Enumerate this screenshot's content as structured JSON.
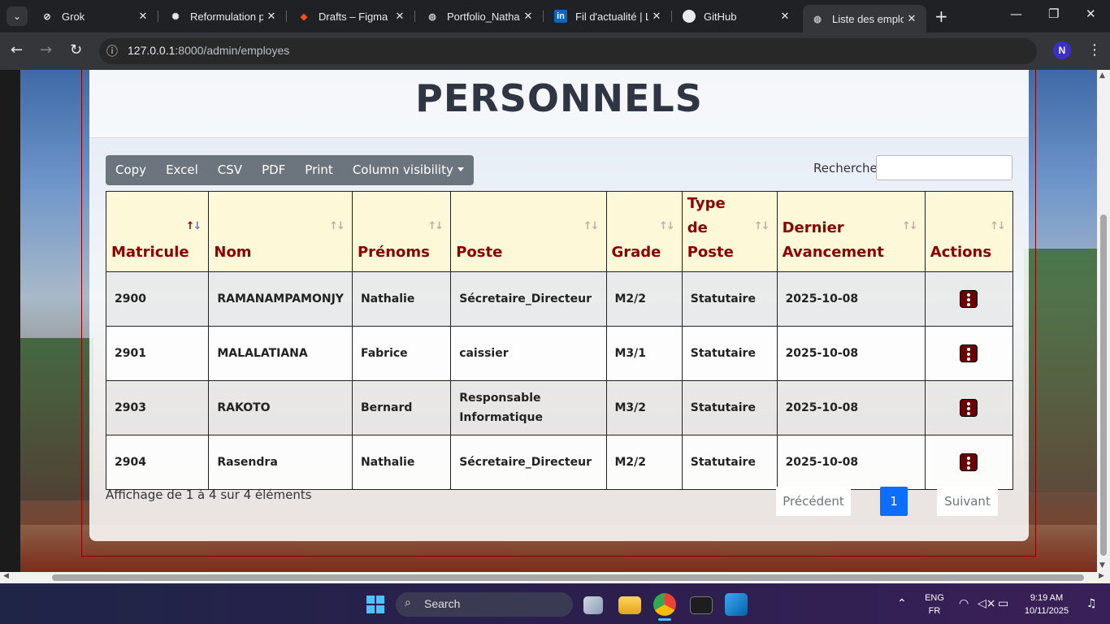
{
  "browser": {
    "tabs": [
      {
        "title": "Grok",
        "icon": "grok-icon"
      },
      {
        "title": "Reformulation p",
        "icon": "chatgpt-icon"
      },
      {
        "title": "Drafts – Figma",
        "icon": "figma-icon"
      },
      {
        "title": "Portfolio_Nathal",
        "icon": "globe-icon"
      },
      {
        "title": "Fil d'actualité | L",
        "icon": "linkedin-icon"
      },
      {
        "title": "GitHub",
        "icon": "github-icon"
      },
      {
        "title": "Liste des employ",
        "icon": "globe-icon"
      }
    ],
    "url_host": "127.0.0.1",
    "url_path": ":8000/admin/employes",
    "profile_initial": "N"
  },
  "page": {
    "title": "PERSONNELS",
    "export_buttons": [
      "Copy",
      "Excel",
      "CSV",
      "PDF",
      "Print",
      "Column visibility"
    ],
    "search_label": "Recherche",
    "search_value": ""
  },
  "table": {
    "columns": [
      "Matricule",
      "Nom",
      "Prénoms",
      "Poste",
      "Grade",
      "Type de Poste",
      "Dernier Avancement",
      "Actions"
    ],
    "rows": [
      {
        "matricule": "2900",
        "nom": "RAMANAMPAMONJY",
        "prenoms": "Nathalie",
        "poste": "Sécretaire_Directeur",
        "grade": "M2/2",
        "type": "Statutaire",
        "avancement": "2025-10-08"
      },
      {
        "matricule": "2901",
        "nom": "MALALATIANA",
        "prenoms": "Fabrice",
        "poste": "caissier",
        "grade": "M3/1",
        "type": "Statutaire",
        "avancement": "2025-10-08"
      },
      {
        "matricule": "2903",
        "nom": "RAKOTO",
        "prenoms": "Bernard",
        "poste": "Responsable Informatique",
        "grade": "M3/2",
        "type": "Statutaire",
        "avancement": "2025-10-08"
      },
      {
        "matricule": "2904",
        "nom": "Rasendra",
        "prenoms": "Nathalie",
        "poste": "Sécretaire_Directeur",
        "grade": "M2/2",
        "type": "Statutaire",
        "avancement": "2025-10-08"
      }
    ]
  },
  "footer": {
    "info": "Affichage de 1 à 4 sur 4 éléments",
    "prev": "Précédent",
    "current_page": "1",
    "next": "Suivant"
  },
  "taskbar": {
    "search_placeholder": "Search",
    "lang_top": "ENG",
    "lang_bottom": "FR",
    "time": "9:19 AM",
    "date": "10/11/2025"
  },
  "colors": {
    "header_bg": "#fdf8d7",
    "header_text": "#8b0000",
    "action_button": "#6b0000",
    "page_active": "#0d6efd"
  }
}
